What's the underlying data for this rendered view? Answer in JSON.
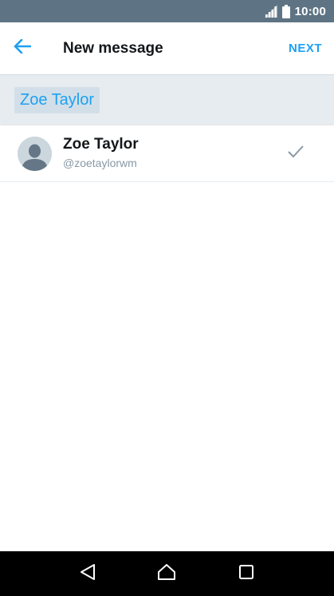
{
  "status_bar": {
    "time": "10:00",
    "icons": [
      "signal-icon",
      "battery-icon"
    ],
    "background": "#5e7484"
  },
  "app_bar": {
    "back_icon": "back-arrow-icon",
    "title": "New message",
    "next_label": "NEXT",
    "accent": "#1da1f2"
  },
  "recipients": {
    "chips": [
      "Zoe Taylor"
    ]
  },
  "results": [
    {
      "name": "Zoe Taylor",
      "handle": "@zoetaylorwm",
      "avatar_icon": "default-avatar-icon",
      "selected_icon": "checkmark-icon"
    }
  ],
  "nav_bar": {
    "buttons": [
      "back-triangle-icon",
      "home-icon",
      "recents-square-icon"
    ]
  }
}
